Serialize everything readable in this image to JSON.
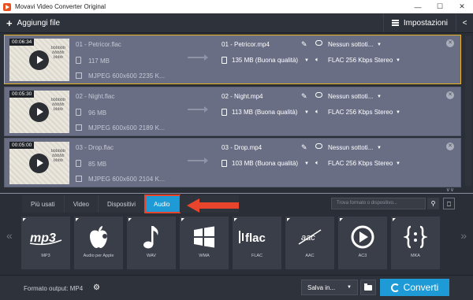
{
  "window": {
    "title": "Movavi Video Converter Original"
  },
  "toolbar": {
    "add_label": "Aggiungi file",
    "settings_label": "Impostazioni"
  },
  "files": [
    {
      "time": "00:06:34",
      "src_name": "01 - Petricor.flac",
      "src_size": "117 MB",
      "src_meta": "MJPEG 600x600 2235 K...",
      "out_name": "01 - Petricor.mp4",
      "out_size": "135 MB (Buona qualità)",
      "subtitles": "Nessun sottoti...",
      "audio": "FLAC 256 Kbps Stereo",
      "selected": true
    },
    {
      "time": "00:05:30",
      "src_name": "02 - Night.flac",
      "src_size": "96 MB",
      "src_meta": "MJPEG 600x600 2189 K...",
      "out_name": "02 - Night.mp4",
      "out_size": "113 MB (Buona qualità)",
      "subtitles": "Nessun sottoti...",
      "audio": "FLAC 256 Kbps Stereo",
      "selected": false
    },
    {
      "time": "00:05:00",
      "src_name": "03 - Drop.flac",
      "src_size": "85 MB",
      "src_meta": "MJPEG 600x600 2104 K...",
      "out_name": "03 - Drop.mp4",
      "out_size": "103 MB (Buona qualità)",
      "subtitles": "Nessun sottoti...",
      "audio": "FLAC 256 Kbps Stereo",
      "selected": false
    }
  ],
  "format_tabs": [
    "Più usati",
    "Video",
    "Dispositivi",
    "Audio"
  ],
  "active_tab": "Audio",
  "search": {
    "placeholder": "Trova formato o dispositivo..."
  },
  "presets": [
    {
      "label": "MP3",
      "icon": "mp3-icon"
    },
    {
      "label": "Audio per Apple",
      "icon": "apple-icon"
    },
    {
      "label": "WAV",
      "icon": "music-note-icon"
    },
    {
      "label": "WMA",
      "icon": "windows-icon"
    },
    {
      "label": "FLAC",
      "icon": "flac-icon"
    },
    {
      "label": "AAC",
      "icon": "aac-icon"
    },
    {
      "label": "AC3",
      "icon": "ac3-icon"
    },
    {
      "label": "MKA",
      "icon": "mka-icon"
    }
  ],
  "bottom": {
    "output_format": "Formato output: MP4",
    "save_label": "Salva in...",
    "convert_label": "Converti"
  },
  "colors": {
    "accent": "#1e9ad6",
    "highlight": "#e8452c",
    "selected_border": "#e8b320",
    "row_bg": "#6a6e85"
  }
}
